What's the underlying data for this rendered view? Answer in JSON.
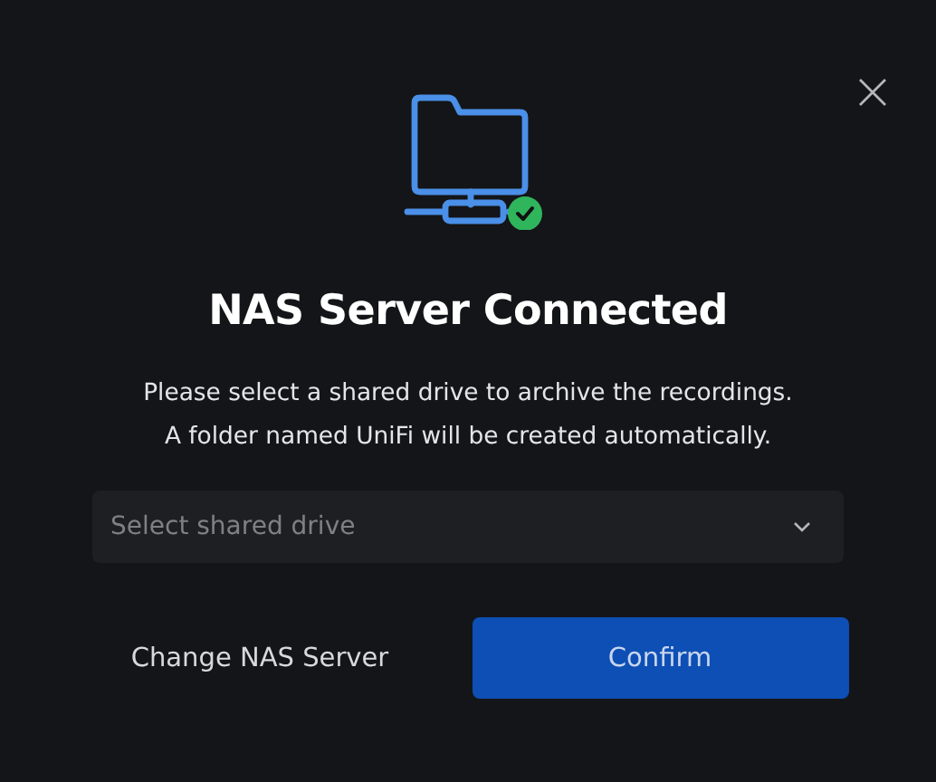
{
  "dialog": {
    "title": "NAS Server Connected",
    "description": [
      "Please select a shared drive to archive the recordings.",
      "A folder named UniFi will be created automatically."
    ],
    "drive_select": {
      "placeholder": "Select shared drive"
    },
    "buttons": [
      {
        "label": "Change NAS Server",
        "kind": "secondary"
      },
      {
        "label": "Confirm",
        "kind": "primary"
      }
    ]
  }
}
